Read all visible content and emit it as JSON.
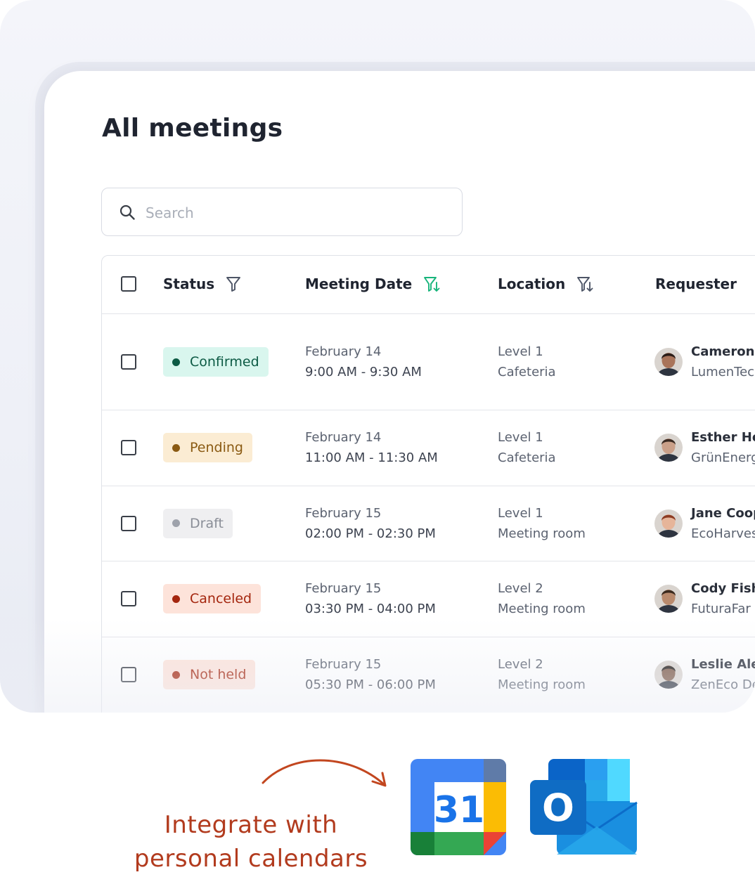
{
  "page": {
    "title": "All meetings"
  },
  "search": {
    "placeholder": "Search"
  },
  "table": {
    "columns": [
      "Status",
      "Meeting Date",
      "Location",
      "Requester"
    ],
    "rows": [
      {
        "status": "Confirmed",
        "date": "February 14",
        "time": "9:00 AM - 9:30 AM",
        "location_level": "Level 1",
        "location_room": "Cafeteria",
        "requester_name": "Cameron W",
        "requester_company": "LumenTec"
      },
      {
        "status": "Pending",
        "date": "February 14",
        "time": "11:00 AM - 11:30 AM",
        "location_level": "Level 1",
        "location_room": "Cafeteria",
        "requester_name": "Esther Ho",
        "requester_company": "GrünEnerg"
      },
      {
        "status": "Draft",
        "date": "February 15",
        "time": "02:00 PM - 02:30 PM",
        "location_level": "Level 1",
        "location_room": "Meeting room",
        "requester_name": "Jane Coop",
        "requester_company": "EcoHarves"
      },
      {
        "status": "Canceled",
        "date": "February 15",
        "time": "03:30 PM - 04:00 PM",
        "location_level": "Level 2",
        "location_room": "Meeting room",
        "requester_name": "Cody Fishe",
        "requester_company": "FuturaFar"
      },
      {
        "status": "Not held",
        "date": "February 15",
        "time": "05:30 PM - 06:00 PM",
        "location_level": "Level 2",
        "location_room": "Meeting room",
        "requester_name": "Leslie Ale",
        "requester_company": "ZenEco De"
      }
    ]
  },
  "status_colors": {
    "Confirmed": {
      "bg": "#d9f6ee",
      "dot": "#0c5a44",
      "text": "#0c5a44"
    },
    "Pending": {
      "bg": "#fbecd3",
      "dot": "#8a5a12",
      "text": "#8a5a12"
    },
    "Draft": {
      "bg": "#efeff1",
      "dot": "#9ea2ab",
      "text": "#8a8e97"
    },
    "Canceled": {
      "bg": "#fde3da",
      "dot": "#a4260e",
      "text": "#a4260e"
    },
    "Not held": {
      "bg": "#fde3da",
      "dot": "#a4260e",
      "text": "#a4260e"
    }
  },
  "promo": {
    "line1": "Integrate with",
    "line2": "personal calendars",
    "google_calendar_day": "31",
    "outlook_letter": "O",
    "color": "#b23b1e"
  },
  "icons": {
    "search": "search-icon",
    "filter": "filter-icon",
    "filter_sort": "filter-sort-icon",
    "calendar": "google-calendar-icon",
    "outlook": "outlook-icon"
  }
}
